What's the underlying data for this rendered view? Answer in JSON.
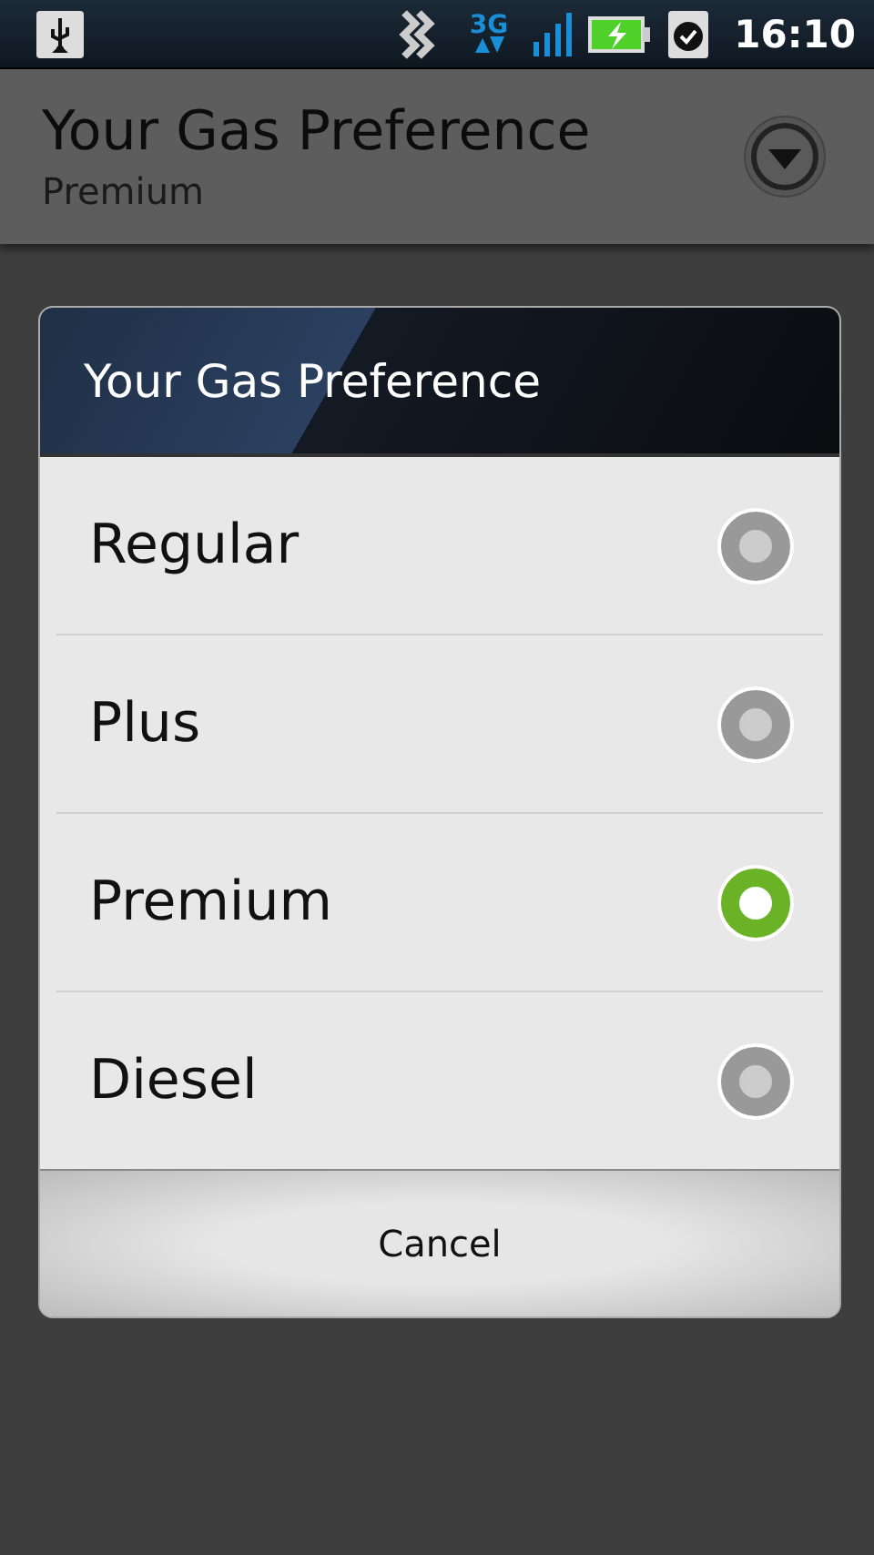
{
  "status_bar": {
    "network": "3G",
    "time": "16:10"
  },
  "header": {
    "title": "Your Gas Preference",
    "subtitle": "Premium"
  },
  "dialog": {
    "title": "Your Gas Preference",
    "options": [
      {
        "label": "Regular",
        "selected": false
      },
      {
        "label": "Plus",
        "selected": false
      },
      {
        "label": "Premium",
        "selected": true
      },
      {
        "label": "Diesel",
        "selected": false
      }
    ],
    "cancel_button": "Cancel"
  }
}
